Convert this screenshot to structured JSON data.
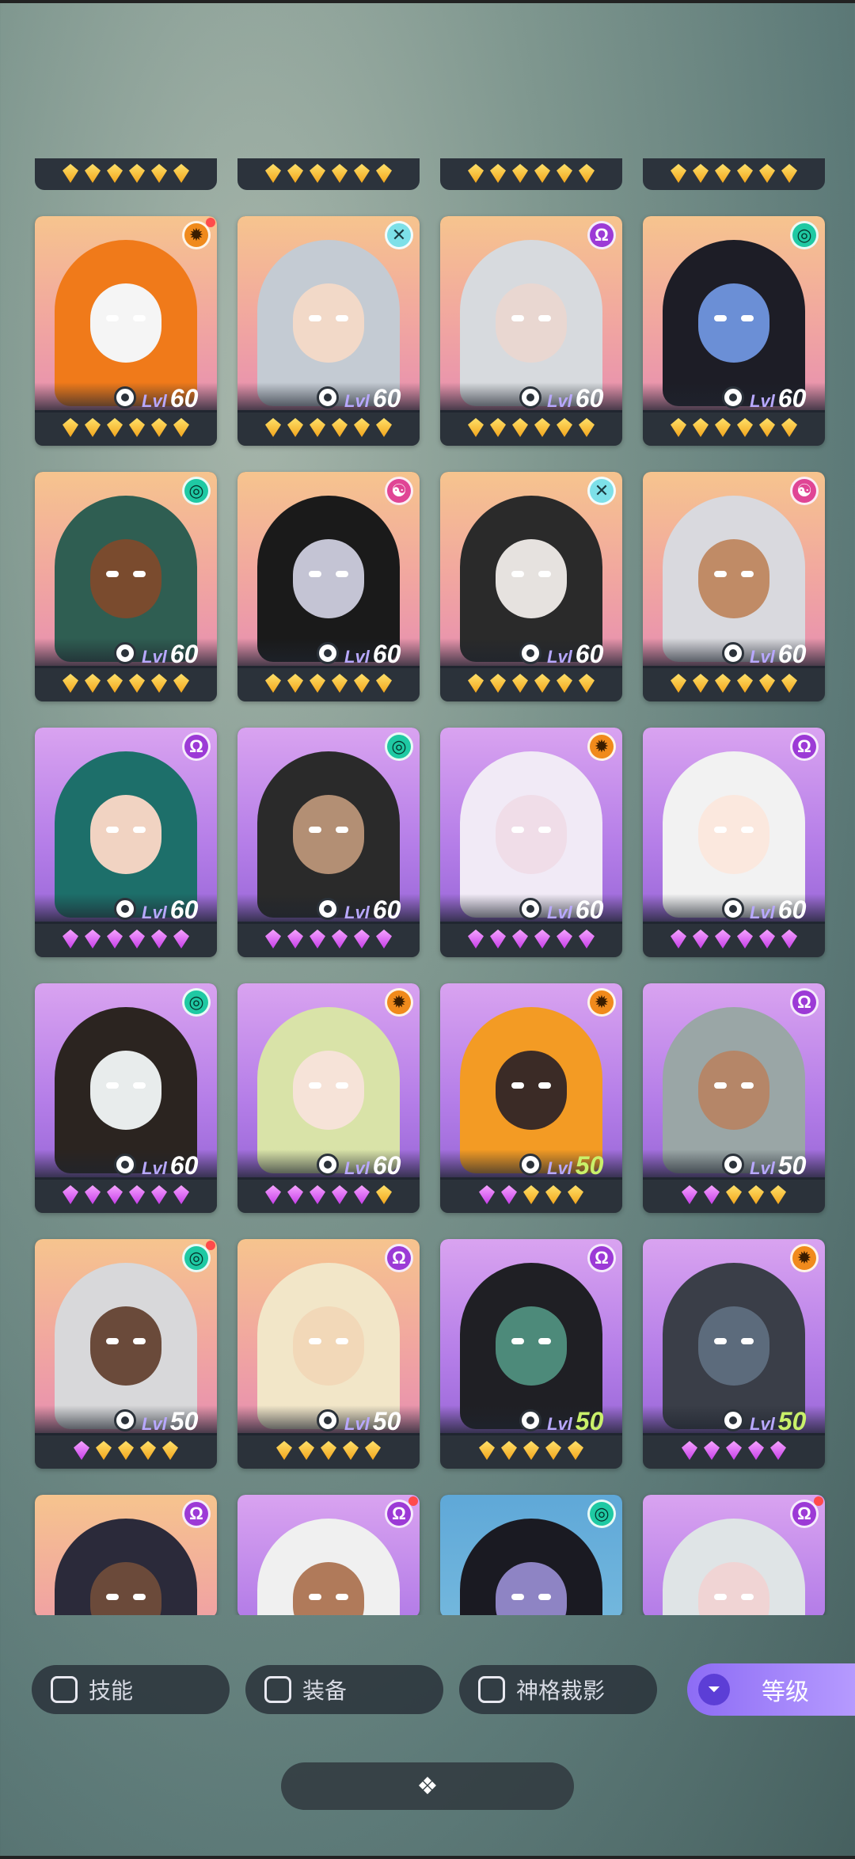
{
  "cards": [
    {
      "name": "card-r1c1",
      "bg": "orange",
      "level": "60",
      "gems": [
        "gold",
        "gold",
        "gold",
        "gold",
        "gold",
        "gold"
      ],
      "badge": "orange",
      "badge_icon": "sun-icon",
      "dot": true,
      "char_color": "#f07a1a",
      "face_color": "#f5f5f5"
    },
    {
      "name": "card-r1c2",
      "bg": "orange",
      "level": "60",
      "gems": [
        "gold",
        "gold",
        "gold",
        "gold",
        "gold",
        "gold"
      ],
      "badge": "grey",
      "badge_icon": "cross-icon",
      "dot": false,
      "char_color": "#c4cbd3",
      "face_color": "#f2d9c8"
    },
    {
      "name": "card-r1c3",
      "bg": "orange",
      "level": "60",
      "gems": [
        "gold",
        "gold",
        "gold",
        "gold",
        "gold",
        "gold"
      ],
      "badge": "purple",
      "badge_icon": "omega-icon",
      "dot": false,
      "char_color": "#d7dade",
      "face_color": "#e9d7d1"
    },
    {
      "name": "card-r1c4",
      "bg": "orange",
      "level": "60",
      "gems": [
        "gold",
        "gold",
        "gold",
        "gold",
        "gold",
        "gold"
      ],
      "badge": "teal",
      "badge_icon": "swirl-icon",
      "dot": false,
      "char_color": "#1d1d26",
      "face_color": "#6b8fd6"
    },
    {
      "name": "card-r2c1",
      "bg": "orange",
      "level": "60",
      "gems": [
        "gold",
        "gold",
        "gold",
        "gold",
        "gold",
        "gold"
      ],
      "badge": "teal",
      "badge_icon": "swirl-icon",
      "dot": false,
      "char_color": "#2f5e52",
      "face_color": "#7a4b2e"
    },
    {
      "name": "card-r2c2",
      "bg": "orange",
      "level": "60",
      "gems": [
        "gold",
        "gold",
        "gold",
        "gold",
        "gold",
        "gold"
      ],
      "badge": "pink",
      "badge_icon": "yin-icon",
      "dot": false,
      "char_color": "#1a1a1a",
      "face_color": "#c4c4d4"
    },
    {
      "name": "card-r2c3",
      "bg": "orange",
      "level": "60",
      "gems": [
        "gold",
        "gold",
        "gold",
        "gold",
        "gold",
        "gold"
      ],
      "badge": "grey",
      "badge_icon": "cross-icon",
      "dot": false,
      "char_color": "#2a2a2a",
      "face_color": "#e6e2df"
    },
    {
      "name": "card-r2c4",
      "bg": "orange",
      "level": "60",
      "gems": [
        "gold",
        "gold",
        "gold",
        "gold",
        "gold",
        "gold"
      ],
      "badge": "pink",
      "badge_icon": "yin-icon",
      "dot": false,
      "char_color": "#d9d9de",
      "face_color": "#c08b66"
    },
    {
      "name": "card-r3c1",
      "bg": "purple",
      "level": "60",
      "gems": [
        "purple",
        "purple",
        "purple",
        "purple",
        "purple",
        "purple"
      ],
      "badge": "purple",
      "badge_icon": "omega-icon",
      "dot": false,
      "char_color": "#1d6f6a",
      "face_color": "#f1d3c2"
    },
    {
      "name": "card-r3c2",
      "bg": "purple",
      "level": "60",
      "gems": [
        "purple",
        "purple",
        "purple",
        "purple",
        "purple",
        "purple"
      ],
      "badge": "teal",
      "badge_icon": "swirl-icon",
      "dot": false,
      "char_color": "#2a2a2a",
      "face_color": "#b38f74"
    },
    {
      "name": "card-r3c3",
      "bg": "purple",
      "level": "60",
      "gems": [
        "purple",
        "purple",
        "purple",
        "purple",
        "purple",
        "purple"
      ],
      "badge": "orange",
      "badge_icon": "sun-icon",
      "dot": false,
      "char_color": "#f1eaf6",
      "face_color": "#f0dde8"
    },
    {
      "name": "card-r3c4",
      "bg": "purple",
      "level": "60",
      "gems": [
        "purple",
        "purple",
        "purple",
        "purple",
        "purple",
        "purple"
      ],
      "badge": "purple",
      "badge_icon": "omega-icon",
      "dot": false,
      "char_color": "#f2f2f2",
      "face_color": "#fbe8de"
    },
    {
      "name": "card-r4c1",
      "bg": "purple",
      "level": "60",
      "gems": [
        "purple",
        "purple",
        "purple",
        "purple",
        "purple",
        "purple"
      ],
      "badge": "teal",
      "badge_icon": "swirl-icon",
      "dot": false,
      "char_color": "#2b2420",
      "face_color": "#e8ecec"
    },
    {
      "name": "card-r4c2",
      "bg": "purple",
      "level": "60",
      "gems": [
        "purple",
        "purple",
        "purple",
        "purple",
        "purple",
        "gold"
      ],
      "badge": "orange",
      "badge_icon": "sun-icon",
      "dot": false,
      "char_color": "#d9e3a8",
      "face_color": "#f6e3d8"
    },
    {
      "name": "card-r4c3",
      "bg": "purple",
      "level": "50",
      "gems": [
        "purple",
        "purple",
        "gold",
        "gold",
        "gold"
      ],
      "badge": "orange",
      "badge_icon": "sun-icon",
      "dot": false,
      "char_color": "#f39b24",
      "face_color": "#3b2b26",
      "green": true
    },
    {
      "name": "card-r4c4",
      "bg": "purple",
      "level": "50",
      "gems": [
        "purple",
        "purple",
        "gold",
        "gold",
        "gold"
      ],
      "badge": "purple",
      "badge_icon": "omega-icon",
      "dot": false,
      "char_color": "#9aa6a6",
      "face_color": "#b58668"
    },
    {
      "name": "card-r5c1",
      "bg": "orange",
      "level": "50",
      "gems": [
        "purple",
        "gold",
        "gold",
        "gold",
        "gold"
      ],
      "badge": "teal",
      "badge_icon": "swirl-icon",
      "dot": true,
      "char_color": "#d8d8da",
      "face_color": "#6a4a3a"
    },
    {
      "name": "card-r5c2",
      "bg": "orange",
      "level": "50",
      "gems": [
        "gold",
        "gold",
        "gold",
        "gold",
        "gold"
      ],
      "badge": "purple",
      "badge_icon": "omega-icon",
      "dot": false,
      "char_color": "#f2e6c8",
      "face_color": "#f2d8b8"
    },
    {
      "name": "card-r5c3",
      "bg": "purple",
      "level": "50",
      "gems": [
        "gold",
        "gold",
        "gold",
        "gold",
        "gold"
      ],
      "badge": "purple",
      "badge_icon": "omega-icon",
      "dot": false,
      "char_color": "#1f1f24",
      "face_color": "#4d8a7a",
      "green": true
    },
    {
      "name": "card-r5c4",
      "bg": "purple",
      "level": "50",
      "gems": [
        "purple",
        "purple",
        "purple",
        "purple",
        "purple"
      ],
      "badge": "orange",
      "badge_icon": "sun-icon",
      "dot": false,
      "char_color": "#3a3e48",
      "face_color": "#5c6b7c",
      "green": true
    },
    {
      "name": "card-r6c1",
      "bg": "orange",
      "partial": true,
      "badge": "purple",
      "badge_icon": "omega-icon",
      "dot": false,
      "char_color": "#2b2a3a",
      "face_color": "#6b4a3a"
    },
    {
      "name": "card-r6c2",
      "bg": "purple",
      "partial": true,
      "badge": "purple",
      "badge_icon": "omega-icon",
      "dot": true,
      "char_color": "#f0f0f0",
      "face_color": "#b07a5a"
    },
    {
      "name": "card-r6c3",
      "bg": "blue",
      "partial": true,
      "badge": "teal",
      "badge_icon": "swirl-icon",
      "dot": false,
      "char_color": "#1a1a22",
      "face_color": "#8e84c4"
    },
    {
      "name": "card-r6c4",
      "bg": "purple",
      "partial": true,
      "badge": "purple",
      "badge_icon": "omega-icon",
      "dot": true,
      "char_color": "#dfe4e6",
      "face_color": "#f0d4d4"
    }
  ],
  "level_prefix": "Lvl",
  "filters": {
    "skill": "技能",
    "equipment": "装备",
    "divine_shadow": "神格裁影"
  },
  "sort": {
    "label": "等级",
    "icon": "double-chevron-icon"
  },
  "bottom_handle_icon": "diamond-cluster-icon"
}
